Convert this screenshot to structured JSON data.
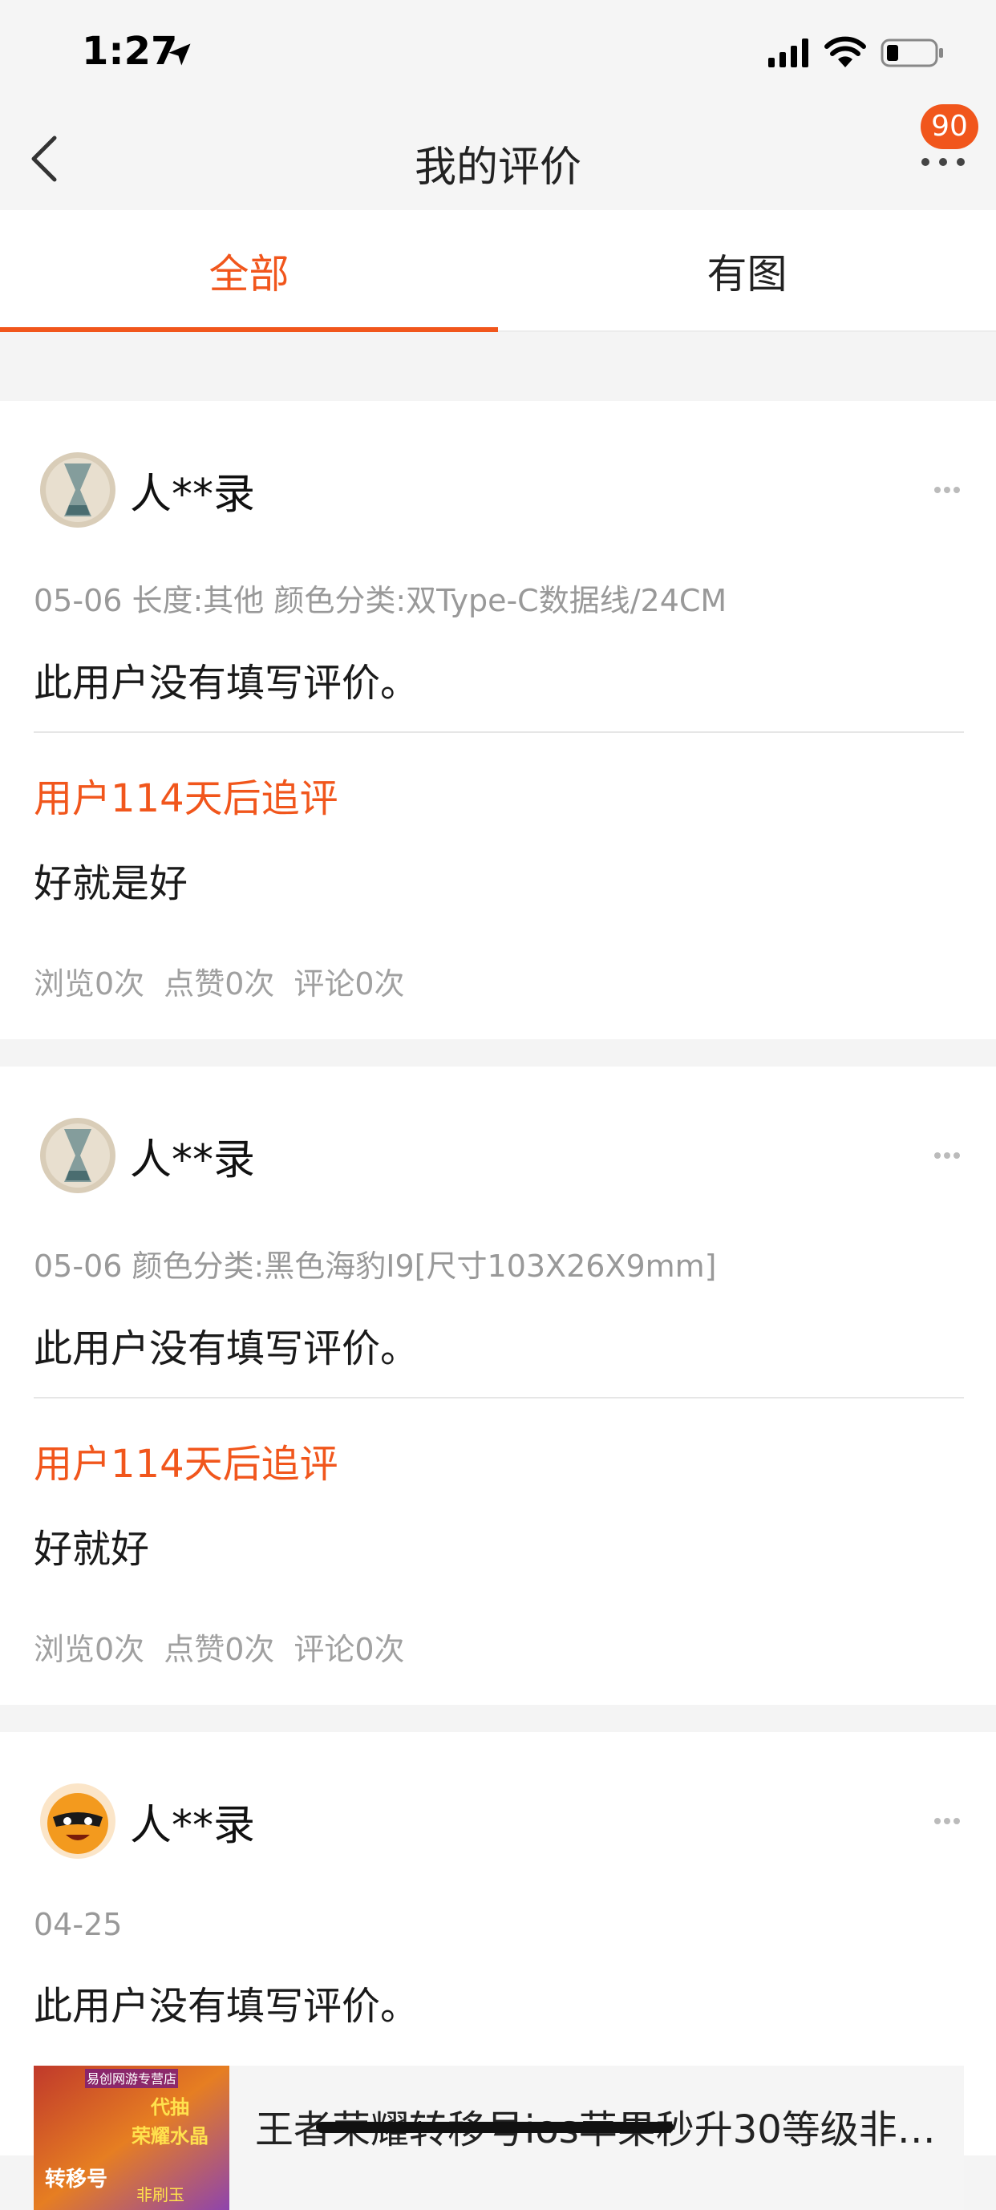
{
  "status_bar": {
    "time": "1:27",
    "icons": [
      "location-arrow-icon",
      "cellular-signal-icon",
      "wifi-icon",
      "battery-icon"
    ]
  },
  "nav": {
    "title": "我的评价",
    "badge": "90",
    "back_icon": "chevron-left-icon",
    "more_icon": "more-dots-icon"
  },
  "tabs": [
    {
      "label": "全部",
      "active": true
    },
    {
      "label": "有图",
      "active": false
    }
  ],
  "colors": {
    "accent": "#f1561c",
    "meta": "#999999",
    "background": "#f4f4f4"
  },
  "reviews": [
    {
      "username": "人**录",
      "meta": "05-06 长度:其他 颜色分类:双Type-C数据线/24CM",
      "content": "此用户没有填写评价。",
      "followup_label": "用户114天后追评",
      "followup_text": "好就是好",
      "stats": {
        "views": "浏览0次",
        "likes": "点赞0次",
        "comments": "评论0次"
      }
    },
    {
      "username": "人**录",
      "meta": "05-06 颜色分类:黑色海豹I9[尺寸103X26X9mm]",
      "content": "此用户没有填写评价。",
      "followup_label": "用户114天后追评",
      "followup_text": "好就好",
      "stats": {
        "views": "浏览0次",
        "likes": "点赞0次",
        "comments": "评论0次"
      }
    },
    {
      "username": "人**录",
      "meta": "04-25",
      "content": "此用户没有填写评价。",
      "product": {
        "title": "王者荣耀转移号ios苹果秒升30等级非…",
        "thumb_texts": [
          "易创网游专营店",
          "代抽",
          "荣耀水晶",
          "转移号",
          "非刷玉"
        ]
      }
    }
  ]
}
